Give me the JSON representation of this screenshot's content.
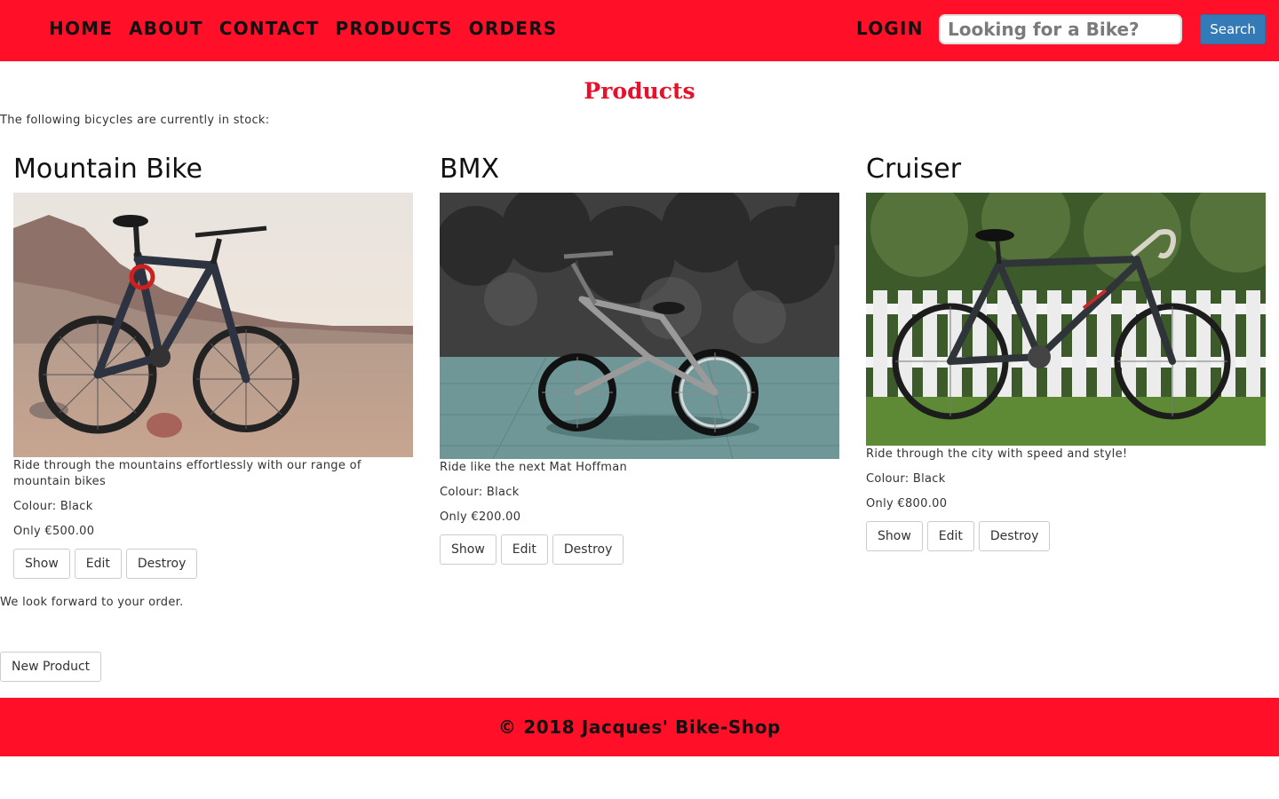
{
  "nav": {
    "links": [
      "HOME",
      "ABOUT",
      "CONTACT",
      "PRODUCTS",
      "ORDERS"
    ],
    "login": "LOGIN",
    "search_placeholder": "Looking for a Bike?",
    "search_button": "Search"
  },
  "main": {
    "title": "Products",
    "intro": "The following bicycles are currently in stock:",
    "products": [
      {
        "name": "Mountain Bike",
        "description": "Ride through the mountains effortlessly with our range of mountain bikes",
        "colour": "Colour: Black",
        "price": "Only €500.00",
        "actions": [
          "Show",
          "Edit",
          "Destroy"
        ]
      },
      {
        "name": "BMX",
        "description": "Ride like the next Mat Hoffman",
        "colour": "Colour: Black",
        "price": "Only €200.00",
        "actions": [
          "Show",
          "Edit",
          "Destroy"
        ]
      },
      {
        "name": "Cruiser",
        "description": "Ride through the city with speed and style!",
        "colour": "Colour: Black",
        "price": "Only €800.00",
        "actions": [
          "Show",
          "Edit",
          "Destroy"
        ]
      }
    ],
    "outro": "We look forward to your order.",
    "new_product_button": "New Product"
  },
  "footer": {
    "text": "© 2018 Jacques' Bike-Shop"
  },
  "colors": {
    "brand_red": "#ff1028",
    "title_red": "#e8102a",
    "search_blue": "#337ab7"
  },
  "icons": [
    "mountain-bike-photo",
    "bmx-photo",
    "cruiser-photo"
  ]
}
